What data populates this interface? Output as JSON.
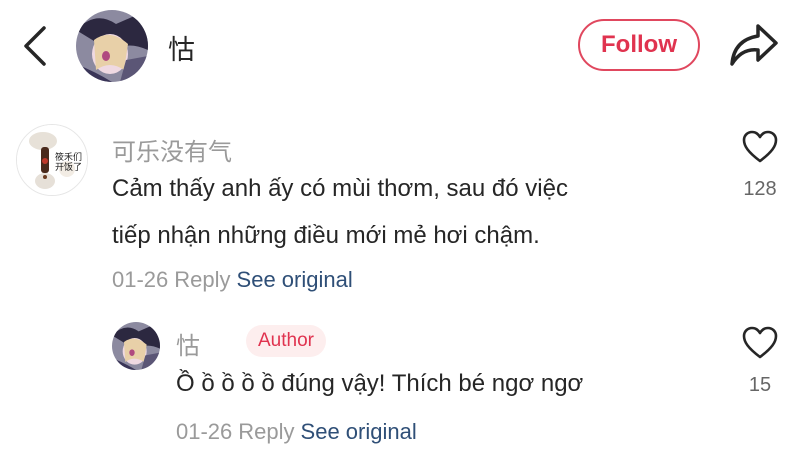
{
  "header": {
    "user_name": "怙",
    "follow_label": "Follow"
  },
  "comments": [
    {
      "user": "可乐没有气",
      "avatar_text": [
        "筱禾们",
        "开饭了"
      ],
      "text_line1": "Cảm thấy anh ấy có mùi thơm, sau đó việc",
      "text_line2": "tiếp nhận những điều mới mẻ hơi chậm.",
      "date": "01-26",
      "reply_label": "Reply",
      "see_original_label": "See original",
      "likes": "128"
    },
    {
      "user": "怙",
      "badge": "Author",
      "text_line1": "Ồ ồ ồ ồ ồ đúng vậy! Thích bé ngơ ngơ",
      "date": "01-26",
      "reply_label": "Reply",
      "see_original_label": "See original",
      "likes": "15"
    }
  ],
  "colors": {
    "accent": "#e0334f",
    "link": "#2f4f77",
    "muted": "#9a9a9a",
    "badge_bg": "#fdeeee"
  },
  "icons": [
    "back-arrow-icon",
    "share-arrow-icon",
    "heart-icon"
  ]
}
